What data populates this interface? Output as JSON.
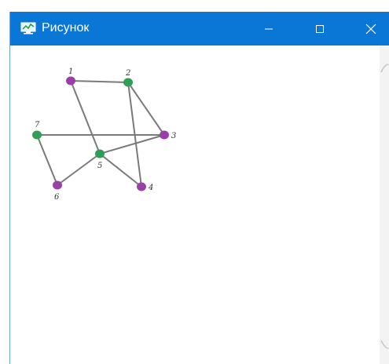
{
  "window": {
    "title": "Рисунок",
    "icon": "plot-icon",
    "controls": {
      "minimize_icon": "minimize-icon",
      "maximize_icon": "maximize-icon",
      "close_icon": "close-icon"
    }
  },
  "colors": {
    "titlebar": "#0a76d6",
    "node_purple": "#9b3fa8",
    "node_green": "#2f9e57",
    "edge": "#7a7a7a"
  },
  "graph": {
    "nodes": [
      {
        "id": "1",
        "label": "1",
        "color": "purple"
      },
      {
        "id": "2",
        "label": "2",
        "color": "green"
      },
      {
        "id": "3",
        "label": "3",
        "color": "purple"
      },
      {
        "id": "4",
        "label": "4",
        "color": "purple"
      },
      {
        "id": "5",
        "label": "5",
        "color": "green"
      },
      {
        "id": "6",
        "label": "6",
        "color": "purple"
      },
      {
        "id": "7",
        "label": "7",
        "color": "green"
      }
    ],
    "edges": [
      [
        "1",
        "2"
      ],
      [
        "1",
        "5"
      ],
      [
        "2",
        "3"
      ],
      [
        "2",
        "4"
      ],
      [
        "3",
        "7"
      ],
      [
        "3",
        "5"
      ],
      [
        "5",
        "4"
      ],
      [
        "5",
        "6"
      ],
      [
        "7",
        "6"
      ]
    ]
  }
}
